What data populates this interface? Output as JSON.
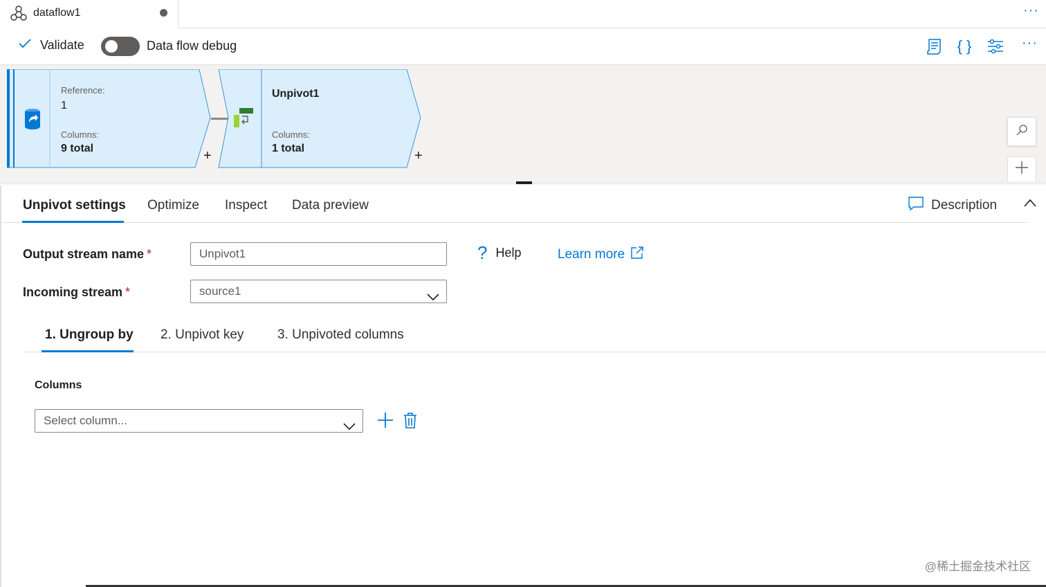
{
  "tab": {
    "title": "dataflow1",
    "more": "···"
  },
  "toolbar": {
    "validate_label": "Validate",
    "debug_label": "Data flow debug",
    "debug_on": false,
    "more": "···"
  },
  "canvas": {
    "source_node": {
      "reference_label": "Reference:",
      "reference_value": "1",
      "columns_label": "Columns:",
      "columns_value": "9 total"
    },
    "unpivot_node": {
      "name": "Unpivot1",
      "columns_label": "Columns:",
      "columns_value": "1 total"
    },
    "plus": "+"
  },
  "settings": {
    "tabs": [
      "Unpivot settings",
      "Optimize",
      "Inspect",
      "Data preview"
    ],
    "active_tab": "Unpivot settings",
    "description_label": "Description"
  },
  "form": {
    "output_stream_label": "Output stream name",
    "output_stream_value": "Unpivot1",
    "incoming_stream_label": "Incoming stream",
    "incoming_stream_value": "source1",
    "required_mark": "*",
    "help_label": "Help",
    "learn_more_label": "Learn more"
  },
  "subtabs": {
    "items": [
      "1. Ungroup by",
      "2. Unpivot key",
      "3. Unpivoted columns"
    ],
    "active": "1. Ungroup by"
  },
  "ungroup": {
    "columns_label": "Columns",
    "select_placeholder": "Select column..."
  },
  "watermark": "@稀土掘金技术社区",
  "colors": {
    "accent": "#0078d4",
    "node_fill": "#dbeefb",
    "node_border": "#3a96dd",
    "canvas_bg": "#f3f2f1"
  }
}
